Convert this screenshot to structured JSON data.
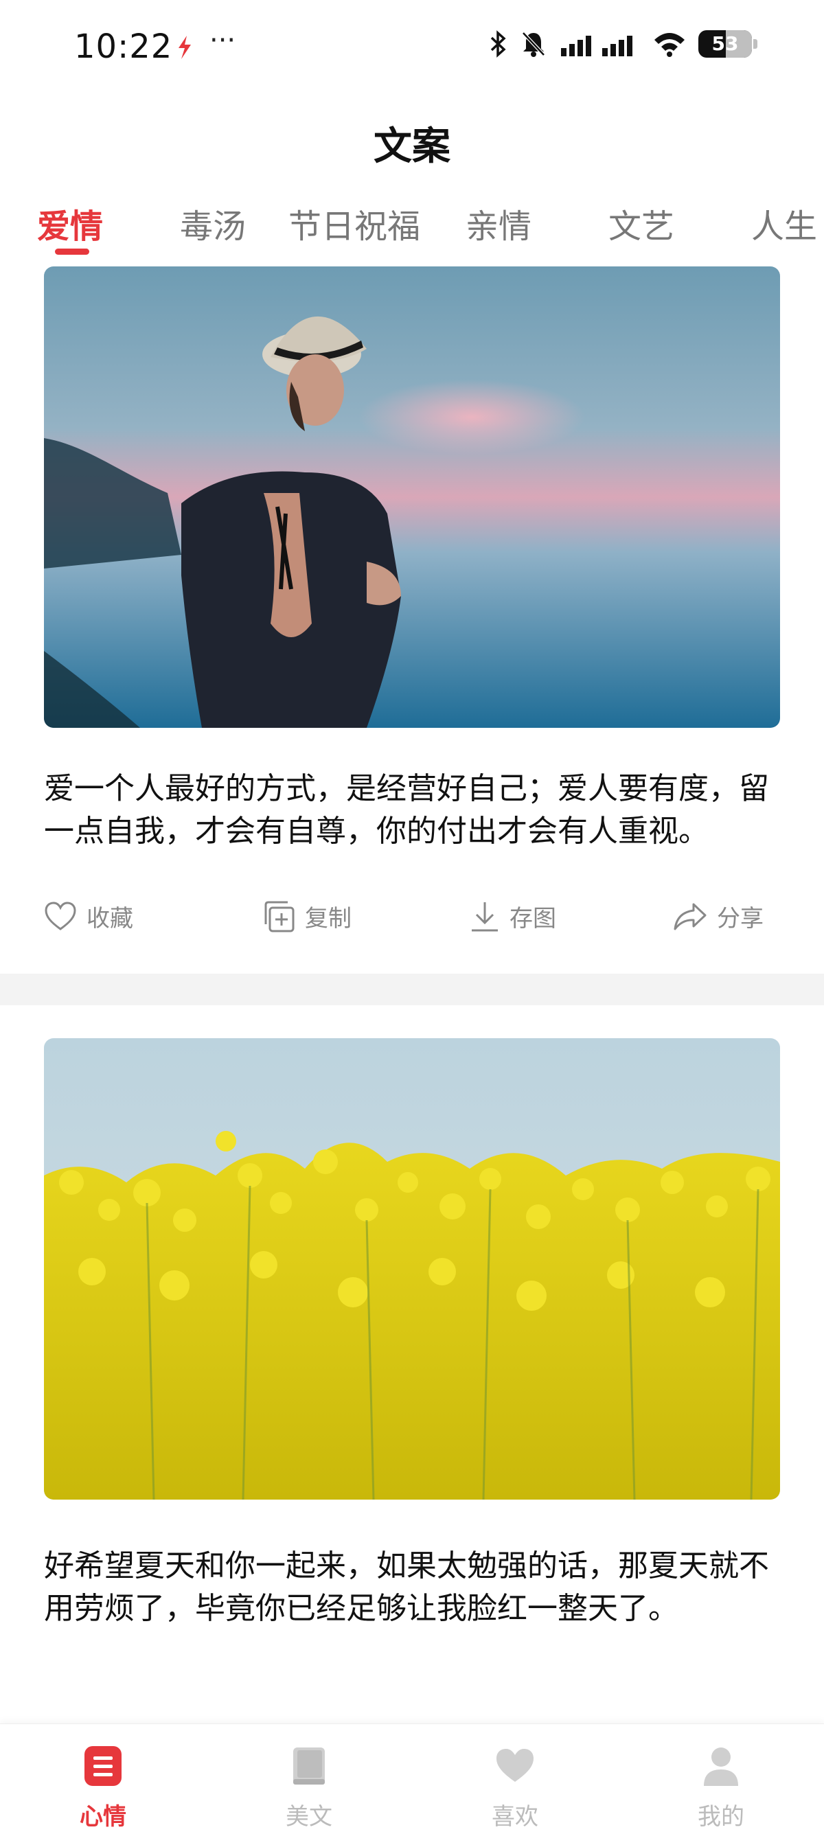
{
  "status": {
    "time": "10:22",
    "more": "···",
    "battery": "53"
  },
  "header": {
    "title": "文案"
  },
  "tabs": [
    {
      "label": "爱情",
      "active": true
    },
    {
      "label": "毒汤"
    },
    {
      "label": "节日祝福"
    },
    {
      "label": "亲情"
    },
    {
      "label": "文艺"
    },
    {
      "label": "人生"
    }
  ],
  "cards": [
    {
      "text": "爱一个人最好的方式，是经营好自己；爱人要有度，留一点自我，才会有自尊，你的付出才会有人重视。",
      "image": "woman-at-lake-photo"
    },
    {
      "text": "好希望夏天和你一起来，如果太勉强的话，那夏天就不用劳烦了，毕竟你已经足够让我脸红一整天了。",
      "image": "rapeseed-flowers-photo"
    }
  ],
  "actions": {
    "collect": "收藏",
    "copy": "复制",
    "save_image": "存图",
    "share": "分享"
  },
  "bottom_nav": [
    {
      "label": "心情",
      "icon": "list-icon",
      "active": true
    },
    {
      "label": "美文",
      "icon": "book-icon"
    },
    {
      "label": "喜欢",
      "icon": "heart-icon"
    },
    {
      "label": "我的",
      "icon": "person-icon"
    }
  ],
  "colors": {
    "accent": "#e6373c",
    "inactive_tab": "#777777",
    "action_gray": "#888888"
  }
}
